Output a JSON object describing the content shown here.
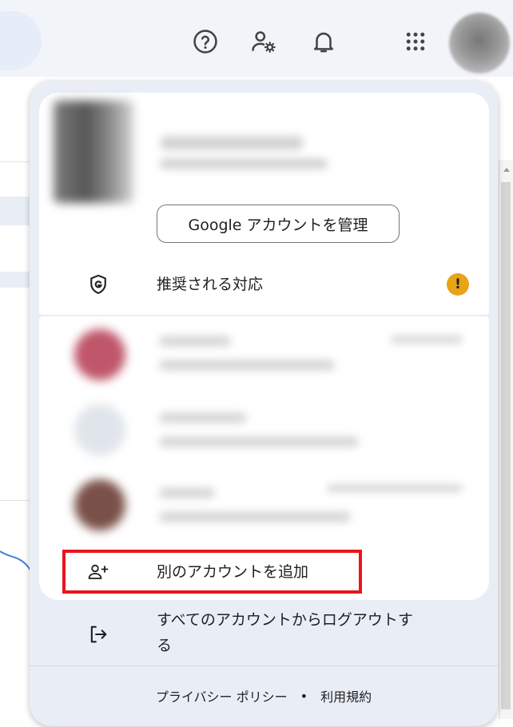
{
  "header": {
    "help_icon": "help-circle-icon",
    "support_icon": "person-settings-icon",
    "notifications_icon": "bell-icon",
    "apps_icon": "apps-grid-icon",
    "avatar_icon": "account-avatar-icon"
  },
  "account_menu": {
    "manage_button": "Google アカウントを管理",
    "recommended_action": {
      "icon": "shield-g-icon",
      "label": "推奨される対応",
      "badge": "!",
      "badge_color": "#e8a317"
    },
    "add_account": {
      "icon": "person-add-icon",
      "label": "別のアカウントを追加"
    },
    "sign_out_all": {
      "icon": "logout-icon",
      "label_line1": "すべてのアカウントからログアウトす",
      "label_line2": "る"
    },
    "footer": {
      "privacy": "プライバシー ポリシー",
      "separator": "•",
      "terms": "利用規約"
    }
  },
  "colors": {
    "highlight": "#e8141c",
    "panel_bg": "#e9eef6",
    "card_bg": "#ffffff"
  }
}
